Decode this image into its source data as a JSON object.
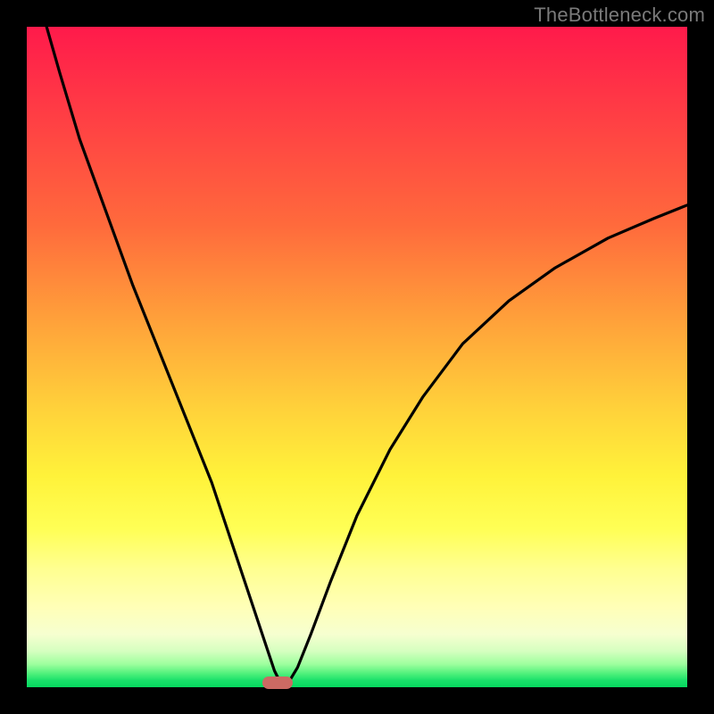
{
  "watermark": "TheBottleneck.com",
  "colors": {
    "frame_border": "#000000",
    "curve_stroke": "#000000",
    "marker_fill": "#cc6a63",
    "gradient_top": "#ff1a4b",
    "gradient_mid": "#ffd23a",
    "gradient_bottom": "#06d85f"
  },
  "chart_data": {
    "type": "line",
    "title": "",
    "xlabel": "",
    "ylabel": "",
    "xlim": [
      0,
      100
    ],
    "ylim": [
      0,
      100
    ],
    "optimum_x": 38,
    "marker": {
      "x": 38,
      "y": 0,
      "width_norm": 4.6,
      "height_norm": 1.9
    },
    "series": [
      {
        "name": "left-branch",
        "x": [
          3,
          5,
          8,
          12,
          16,
          20,
          24,
          28,
          31,
          34,
          36,
          37.5,
          38.5
        ],
        "y": [
          100,
          93,
          83,
          72,
          61,
          51,
          41,
          31,
          22,
          13,
          7,
          2.5,
          0.5
        ]
      },
      {
        "name": "right-branch",
        "x": [
          39.5,
          41,
          43,
          46,
          50,
          55,
          60,
          66,
          73,
          80,
          88,
          95,
          100
        ],
        "y": [
          0.5,
          3,
          8,
          16,
          26,
          36,
          44,
          52,
          58.5,
          63.5,
          68,
          71,
          73
        ]
      }
    ],
    "notes": "No axis ticks, labels, or legend visible. y=100 at top edge, y=0 at bottom edge. Curve touches bottom near x≈38 where a rounded red marker sits on the baseline."
  }
}
